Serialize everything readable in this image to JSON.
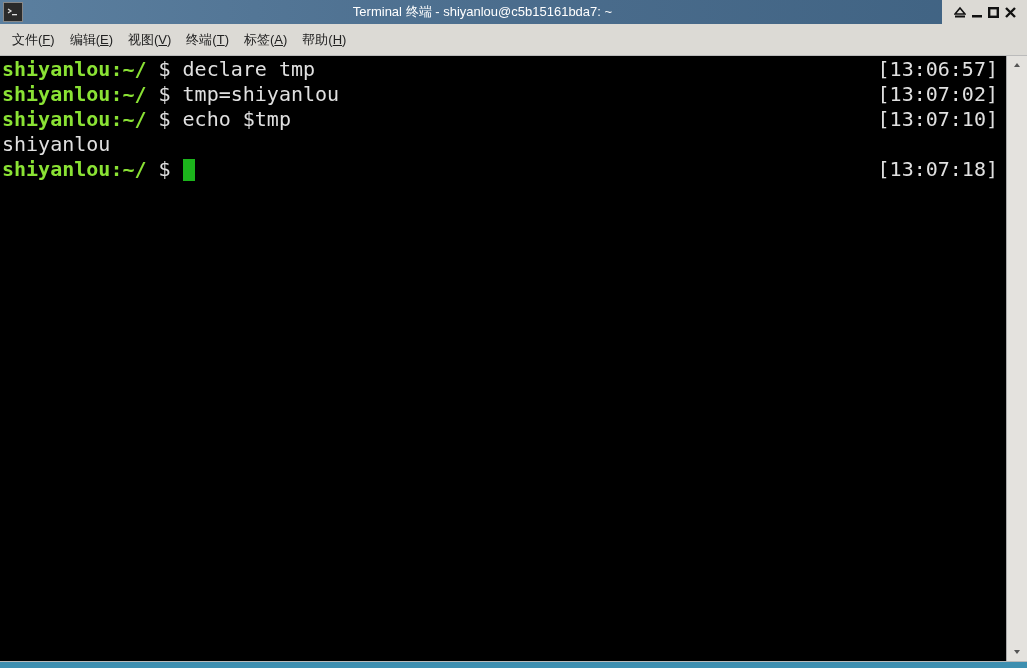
{
  "window": {
    "title": "Terminal 终端 - shiyanlou@c5b15161bda7: ~"
  },
  "menu": [
    {
      "before": "文件(",
      "accel": "F",
      "after": ")"
    },
    {
      "before": "编辑(",
      "accel": "E",
      "after": ")"
    },
    {
      "before": "视图(",
      "accel": "V",
      "after": ")"
    },
    {
      "before": "终端(",
      "accel": "T",
      "after": ")"
    },
    {
      "before": "标签(",
      "accel": "A",
      "after": ")"
    },
    {
      "before": "帮助(",
      "accel": "H",
      "after": ")"
    }
  ],
  "terminal": {
    "lines": [
      {
        "kind": "prompt",
        "user": "shiyanlou",
        "path": ":~/",
        "symbol": "$",
        "command": "declare tmp",
        "time": "[13:06:57]",
        "cursor": false
      },
      {
        "kind": "prompt",
        "user": "shiyanlou",
        "path": ":~/",
        "symbol": "$",
        "command": "tmp=shiyanlou",
        "time": "[13:07:02]",
        "cursor": false
      },
      {
        "kind": "prompt",
        "user": "shiyanlou",
        "path": ":~/",
        "symbol": "$",
        "command": "echo $tmp",
        "time": "[13:07:10]",
        "cursor": false
      },
      {
        "kind": "output",
        "text": "shiyanlou"
      },
      {
        "kind": "prompt",
        "user": "shiyanlou",
        "path": ":~/",
        "symbol": "$",
        "time": "[13:07:18]",
        "cursor": true
      }
    ]
  }
}
